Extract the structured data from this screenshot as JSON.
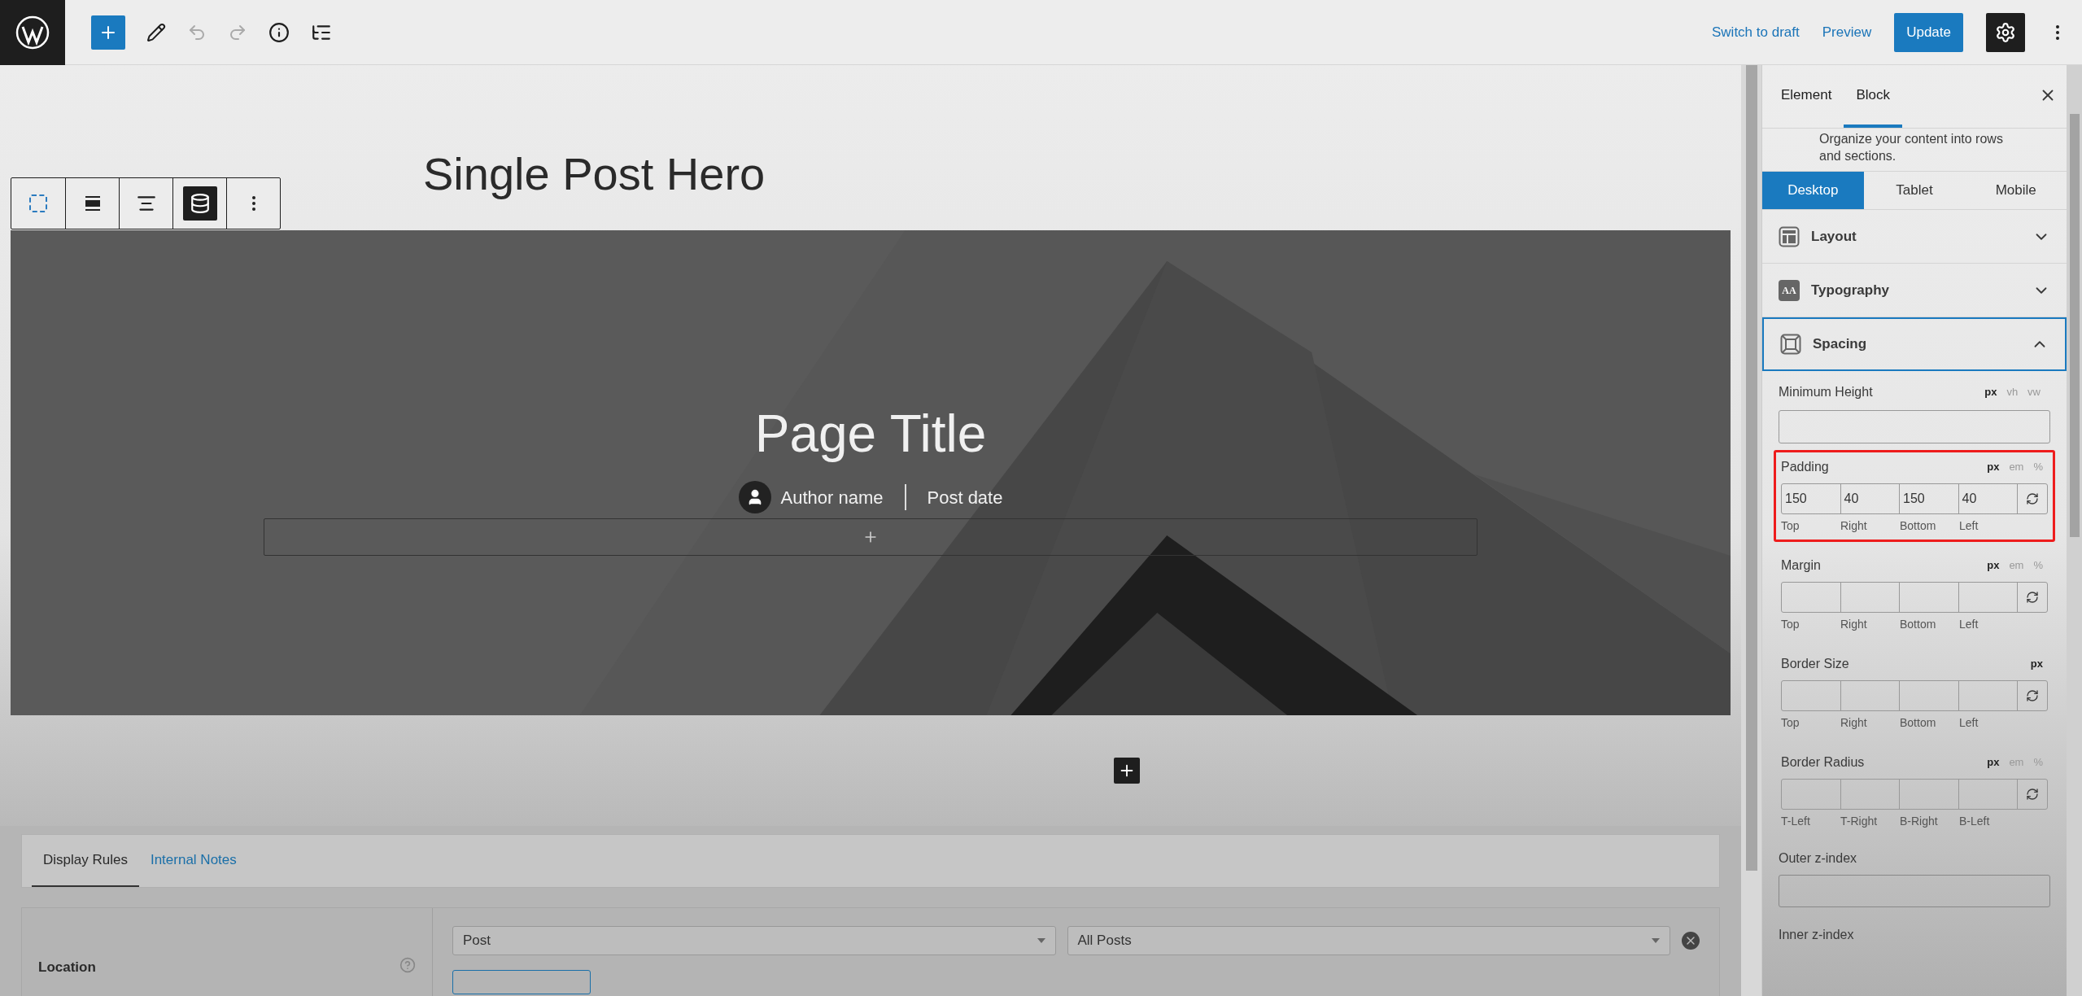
{
  "top_bar": {
    "actions": [
      {
        "label": "Switch to draft",
        "kind": "link"
      },
      {
        "label": "Preview",
        "kind": "link"
      },
      {
        "label": "Update",
        "kind": "primary"
      }
    ],
    "settings_selected": true
  },
  "canvas": {
    "title": "Single Post Hero",
    "block_toolbar": [
      {
        "kind": "select",
        "selected": false
      },
      {
        "kind": "align",
        "selected": false
      },
      {
        "kind": "justify",
        "selected": false
      },
      {
        "kind": "dynamic",
        "selected": true
      },
      {
        "kind": "more",
        "selected": false
      }
    ],
    "hero": {
      "title": "Page Title",
      "author": "Author name",
      "date": "Post date"
    }
  },
  "meta_box": {
    "tabs": [
      {
        "label": "Display Rules",
        "selected": true
      },
      {
        "label": "Internal Notes",
        "selected": false
      }
    ],
    "location": {
      "label": "Location",
      "selects": [
        "Post",
        "All Posts"
      ]
    }
  },
  "sidebar": {
    "tabs": [
      {
        "label": "Element",
        "selected": false
      },
      {
        "label": "Block",
        "selected": true
      }
    ],
    "description": "Organize your content into rows and sections.",
    "devices": [
      {
        "label": "Desktop",
        "selected": true
      },
      {
        "label": "Tablet",
        "selected": false
      },
      {
        "label": "Mobile",
        "selected": false
      }
    ],
    "sections": [
      {
        "label": "Layout",
        "kind": "layout",
        "expanded": false
      },
      {
        "label": "Typography",
        "kind": "typography",
        "glyph": "AA",
        "expanded": false
      },
      {
        "label": "Spacing",
        "kind": "spacing",
        "expanded": true
      }
    ],
    "minimum_height": {
      "label": "Minimum Height",
      "units": [
        {
          "label": "px",
          "selected": true
        },
        {
          "label": "vh",
          "selected": false
        },
        {
          "label": "vw",
          "selected": false
        }
      ]
    },
    "groups": [
      {
        "label": "Padding",
        "highlighted": true,
        "units": [
          {
            "label": "px",
            "selected": true
          },
          {
            "label": "em",
            "selected": false
          },
          {
            "label": "%",
            "selected": false
          }
        ],
        "values": [
          "150",
          "40",
          "150",
          "40"
        ],
        "sublabels": [
          "Top",
          "Right",
          "Bottom",
          "Left"
        ]
      },
      {
        "label": "Margin",
        "highlighted": false,
        "units": [
          {
            "label": "px",
            "selected": true
          },
          {
            "label": "em",
            "selected": false
          },
          {
            "label": "%",
            "selected": false
          }
        ],
        "sublabels": [
          "Top",
          "Right",
          "Bottom",
          "Left"
        ]
      },
      {
        "label": "Border Size",
        "highlighted": false,
        "units": [
          {
            "label": "px",
            "selected": true
          }
        ],
        "sublabels": [
          "Top",
          "Right",
          "Bottom",
          "Left"
        ]
      },
      {
        "label": "Border Radius",
        "highlighted": false,
        "units": [
          {
            "label": "px",
            "selected": true
          },
          {
            "label": "em",
            "selected": false
          },
          {
            "label": "%",
            "selected": false
          }
        ],
        "sublabels": [
          "T-Left",
          "T-Right",
          "B-Right",
          "B-Left"
        ]
      }
    ],
    "outer_z_index": {
      "label": "Outer z-index"
    },
    "inner_z_index": {
      "label": "Inner z-index"
    }
  }
}
